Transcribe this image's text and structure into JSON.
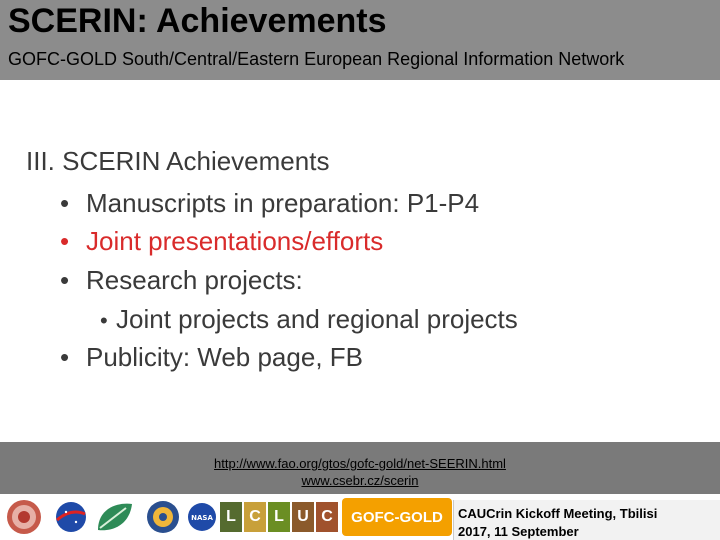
{
  "header": {
    "title": "SCERIN: Achievements",
    "subtitle": "GOFC-GOLD South/Central/Eastern European Regional Information Network"
  },
  "content": {
    "heading": "III. SCERIN Achievements",
    "bullets": [
      "Manuscripts in preparation: P1-P4",
      "Joint presentations/efforts",
      "Research projects:"
    ],
    "sub_bullets": [
      "Joint projects and regional projects"
    ],
    "last_bullet": "Publicity: Web page, FB",
    "bullet_symbol": "•"
  },
  "footer": {
    "links": [
      "http://www.fao.org/gtos/gofc-gold/net-SEERIN.html",
      "www.csebr.cz/scerin"
    ],
    "meeting_line1": "CAUCrin Kickoff Meeting, Tbilisi",
    "meeting_line2": "2017, 11 September",
    "logos": {
      "nasa_label": "NASA",
      "gofc_label": "GOFC-GOLD",
      "lcluc_letters": [
        "L",
        "C",
        "L",
        "U",
        "C"
      ]
    }
  },
  "colors": {
    "header_bg": "#8c8c8c",
    "text": "#3a3a3a",
    "highlight": "#d92b2b",
    "footer_bg": "#7a7a7a"
  }
}
